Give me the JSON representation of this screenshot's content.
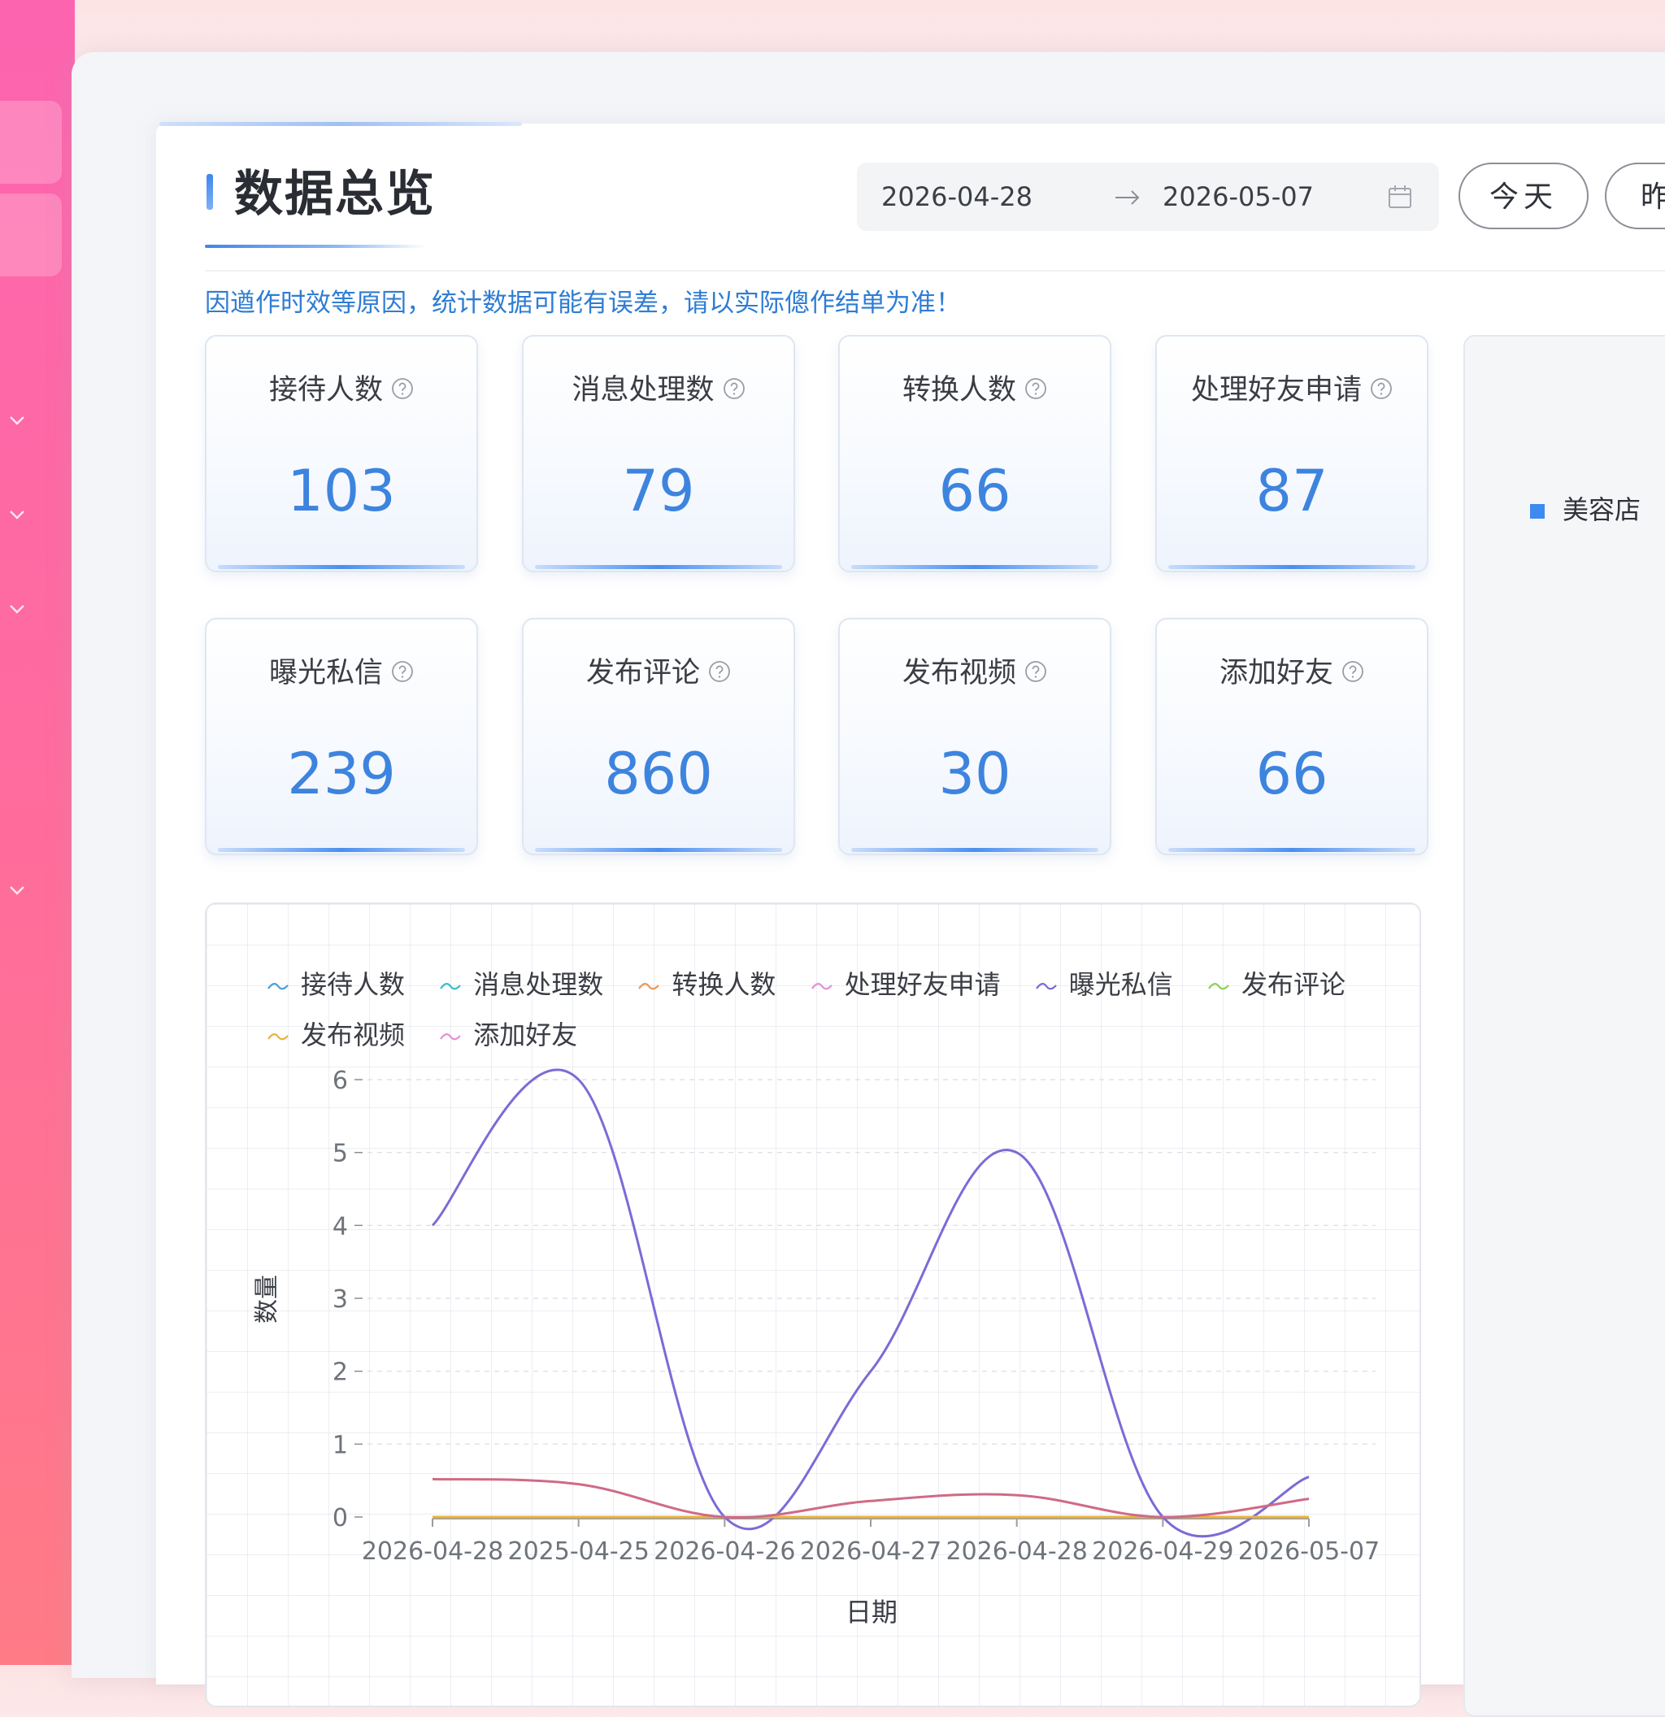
{
  "header": {
    "title": "数据总览",
    "date_start": "2026-04-28",
    "date_end": "2026-05-07",
    "buttons": [
      {
        "label": "今天"
      },
      {
        "label": "昨"
      }
    ]
  },
  "notice": "因遒作时效等原因，统计数据可能有误差，请以实际傯作结单为准！",
  "stats": [
    {
      "label": "接待人数",
      "value": "103"
    },
    {
      "label": "消息处理数",
      "value": "79"
    },
    {
      "label": "转换人数",
      "value": "66"
    },
    {
      "label": "处理好友申请",
      "value": "87"
    },
    {
      "label": "曝光私信",
      "value": "239"
    },
    {
      "label": "发布评论",
      "value": "860"
    },
    {
      "label": "发布视频",
      "value": "30"
    },
    {
      "label": "添加好友",
      "value": "66"
    }
  ],
  "side_panel": {
    "store_label": "美容店",
    "store_color": "#3d8af0"
  },
  "chart_data": {
    "type": "line",
    "xlabel": "日期",
    "ylabel": "数量",
    "ylim": [
      0,
      6
    ],
    "yticks": [
      0,
      1,
      2,
      3,
      4,
      5,
      6
    ],
    "categories": [
      "2026-04-28",
      "2025-04-25",
      "2026-04-26",
      "2026-04-27",
      "2026-04-28",
      "2026-04-29",
      "2026-05-07"
    ],
    "series": [
      {
        "name": "接待人数",
        "color": "#4a9fd8",
        "values": [
          0,
          0,
          0,
          0,
          0,
          0,
          0
        ]
      },
      {
        "name": "消息处理数",
        "color": "#36c0c8",
        "values": [
          0,
          0,
          0,
          0,
          0,
          0,
          0
        ]
      },
      {
        "name": "转换人数",
        "color": "#e89a5a",
        "values": [
          0,
          0,
          0,
          0,
          0,
          0,
          0
        ]
      },
      {
        "name": "处理好友申请",
        "color": "#e48fd8",
        "values": [
          0,
          0,
          0,
          0,
          0,
          0,
          0
        ]
      },
      {
        "name": "曝光私信",
        "color": "#7b6bd6",
        "values": [
          4,
          6,
          0,
          2,
          5,
          0,
          0.55
        ]
      },
      {
        "name": "发布评论",
        "color": "#8ccf5a",
        "values": [
          0,
          0,
          0,
          0,
          0,
          0,
          0
        ]
      },
      {
        "name": "发布视频",
        "color": "#e8b43c",
        "values": [
          0,
          0,
          0,
          0,
          0,
          0,
          0
        ]
      },
      {
        "name": "添加好友",
        "color": "#d06a86",
        "values": [
          0.52,
          0.45,
          0,
          0.22,
          0.3,
          0,
          0.25
        ]
      }
    ],
    "legend_position": "top-left",
    "grid": true
  }
}
